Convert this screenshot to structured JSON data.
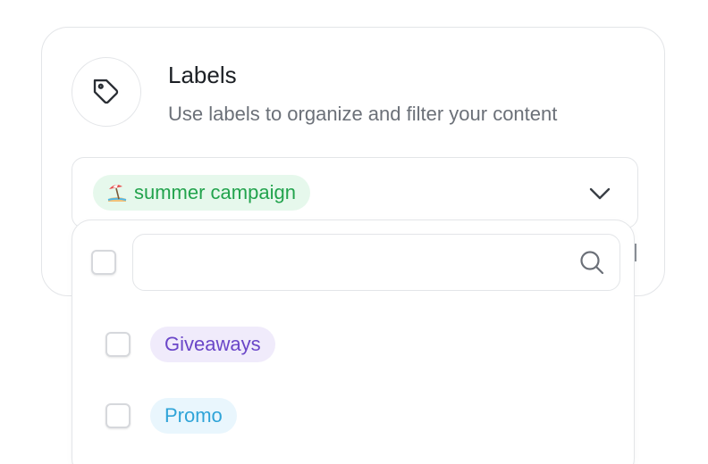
{
  "header": {
    "title": "Labels",
    "subtitle": "Use labels to organize and filter your content",
    "icon": "tag-icon"
  },
  "select": {
    "selected_label": "summer campaign",
    "selected_emoji": "beach-with-umbrella",
    "selected_color": "#22a34d",
    "selected_bg": "#e6f8ec",
    "chevron_icon": "chevron-down-icon"
  },
  "dropdown": {
    "search": {
      "value": "",
      "placeholder": "",
      "icon": "search-icon"
    },
    "options": [
      {
        "label": "Giveaways",
        "checked": false,
        "color": "#6a46c8",
        "bg": "#f0ebfb"
      },
      {
        "label": "Promo",
        "checked": false,
        "color": "#2fa4d8",
        "bg": "#e9f6fd"
      }
    ]
  }
}
